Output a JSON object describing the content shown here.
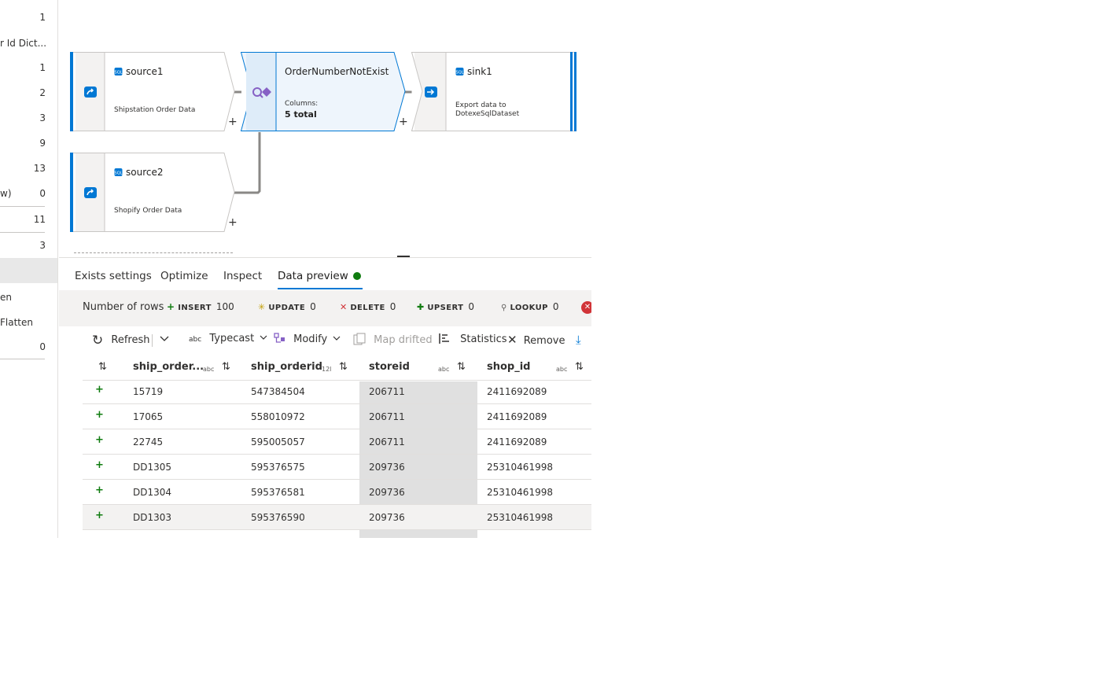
{
  "left_panel": {
    "rows": [
      {
        "label": "",
        "count": "1"
      },
      {
        "label": "r Id Dict...",
        "count": ""
      },
      {
        "label": "",
        "count": "1"
      },
      {
        "label": "",
        "count": "2"
      },
      {
        "label": "",
        "count": "3"
      },
      {
        "label": "",
        "count": "9"
      },
      {
        "label": "",
        "count": "13"
      },
      {
        "label": "w)",
        "count": "0"
      },
      {
        "label": "",
        "count": "11"
      },
      {
        "label": "",
        "count": "3"
      },
      {
        "label": "en",
        "count": ""
      },
      {
        "label": "Flatten",
        "count": ""
      },
      {
        "label": "",
        "count": "0"
      }
    ]
  },
  "canvas": {
    "nodes": {
      "source1": {
        "title": "source1",
        "description": "Shipstation Order Data"
      },
      "exists": {
        "title": "OrderNumberNotExist",
        "columns_label": "Columns:",
        "columns_value": "5 total"
      },
      "sink1": {
        "title": "sink1",
        "description": "Export data to DotexeSqlDataset"
      },
      "source2": {
        "title": "source2",
        "description": "Shopify Order Data"
      }
    },
    "add_symbol": "+"
  },
  "tabs": [
    {
      "label": "Exists settings"
    },
    {
      "label": "Optimize"
    },
    {
      "label": "Inspect"
    },
    {
      "label": "Data preview",
      "active": true
    }
  ],
  "counts": {
    "label": "Number of rows",
    "insert": {
      "label": "INSERT",
      "value": "100"
    },
    "update": {
      "label": "UPDATE",
      "value": "0"
    },
    "delete": {
      "label": "DELETE",
      "value": "0"
    },
    "upsert": {
      "label": "UPSERT",
      "value": "0"
    },
    "lookup": {
      "label": "LOOKUP",
      "value": "0"
    }
  },
  "toolbar": {
    "refresh": "Refresh",
    "typecast_prefix": "abc",
    "typecast": "Typecast",
    "modify": "Modify",
    "map_drifted": "Map drifted",
    "statistics": "Statistics",
    "remove": "Remove"
  },
  "table": {
    "columns": [
      {
        "name": "ship_order...",
        "type": "abc"
      },
      {
        "name": "ship_orderid",
        "type": "12l"
      },
      {
        "name": "storeid",
        "type": "abc"
      },
      {
        "name": "shop_id",
        "type": "abc"
      }
    ],
    "rows": [
      [
        "15719",
        "547384504",
        "206711",
        "2411692089"
      ],
      [
        "17065",
        "558010972",
        "206711",
        "2411692089"
      ],
      [
        "22745",
        "595005057",
        "206711",
        "2411692089"
      ],
      [
        "DD1305",
        "595376575",
        "209736",
        "25310461998"
      ],
      [
        "DD1304",
        "595376581",
        "209736",
        "25310461998"
      ],
      [
        "DD1303",
        "595376590",
        "209736",
        "25310461998"
      ]
    ],
    "row_marker": "+"
  },
  "colors": {
    "accent": "#0078d4",
    "success": "#107c10",
    "error": "#d13438",
    "node_bg": "#ffffff",
    "node_selected_bg": "#eef5fc"
  }
}
